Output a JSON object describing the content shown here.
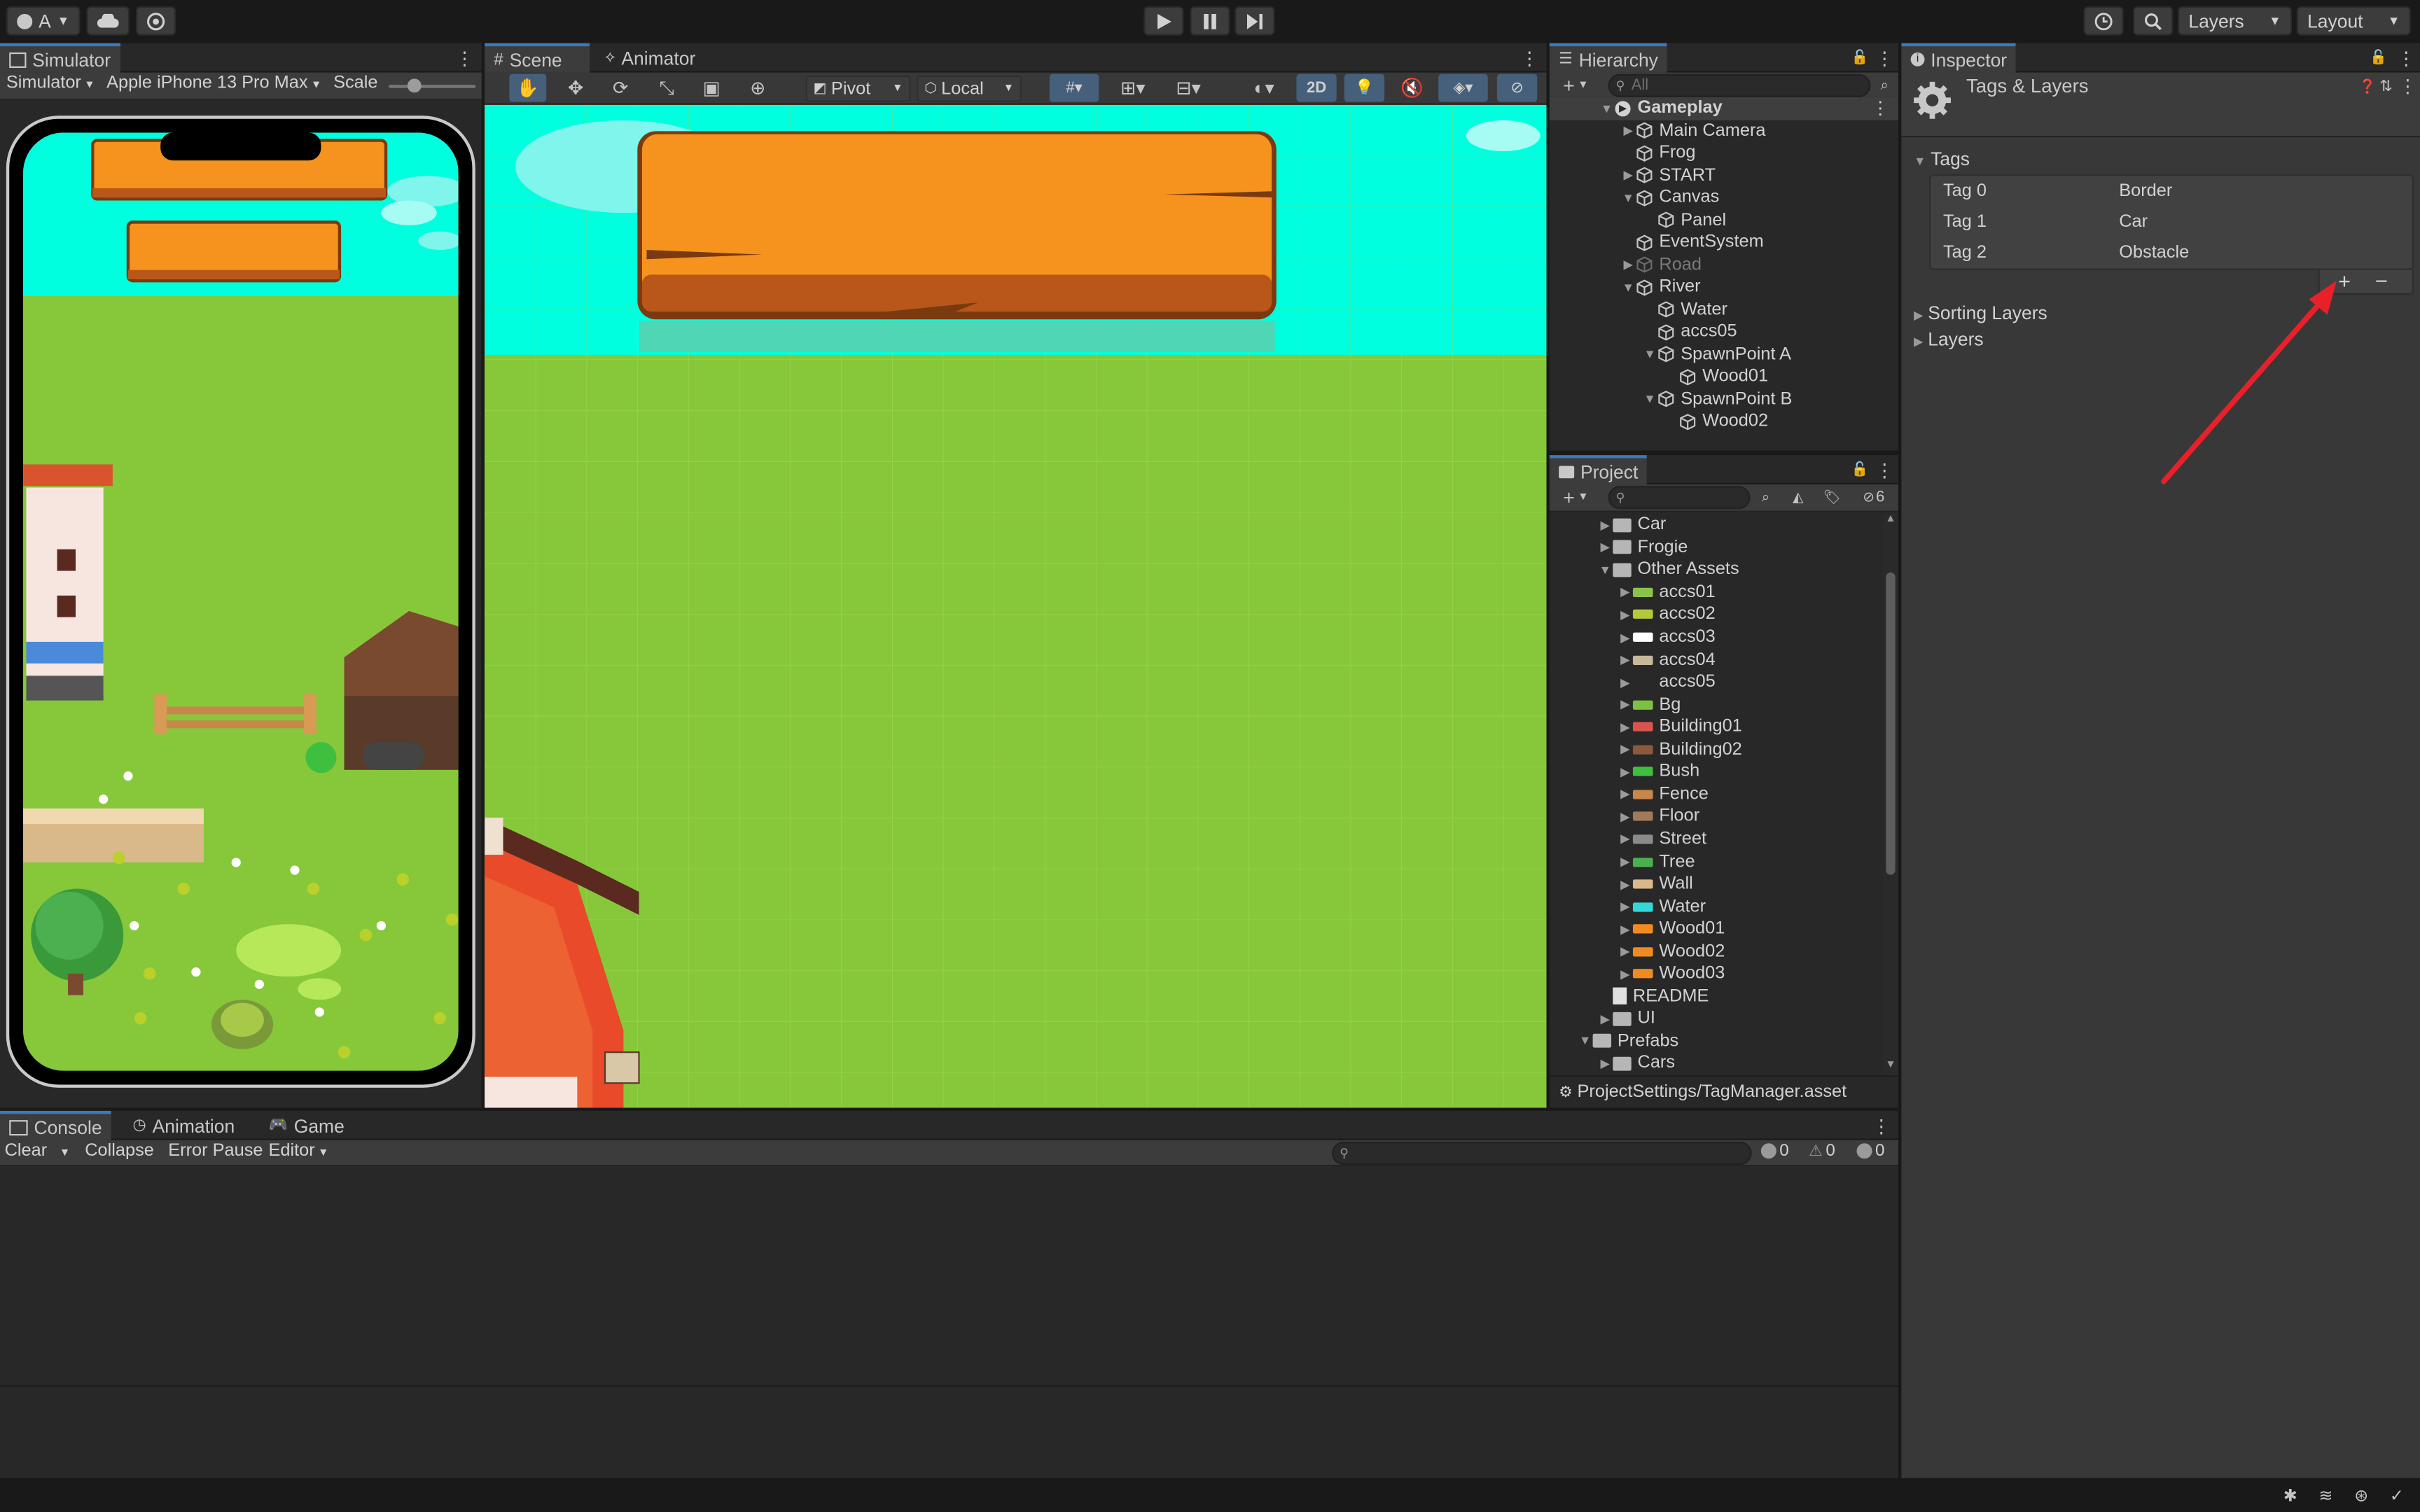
{
  "topbar": {
    "account_label": "A",
    "layers_label": "Layers",
    "layout_label": "Layout"
  },
  "simulator": {
    "tab": "Simulator",
    "mode": "Simulator",
    "device": "Apple iPhone 13 Pro Max",
    "scale_label": "Scale"
  },
  "scene": {
    "tabs": [
      "Scene",
      "Animator"
    ],
    "pivot": "Pivot",
    "local": "Local",
    "mode_2d": "2D"
  },
  "hierarchy": {
    "tab": "Hierarchy",
    "search_placeholder": "All",
    "items": [
      {
        "label": "Gameplay",
        "depth": 0,
        "arrow": "▼",
        "type": "scene",
        "bold": true
      },
      {
        "label": "Main Camera",
        "depth": 1,
        "arrow": "▶",
        "type": "object"
      },
      {
        "label": "Frog",
        "depth": 1,
        "arrow": "",
        "type": "object"
      },
      {
        "label": "START",
        "depth": 1,
        "arrow": "▶",
        "type": "object"
      },
      {
        "label": "Canvas",
        "depth": 1,
        "arrow": "▼",
        "type": "object"
      },
      {
        "label": "Panel",
        "depth": 2,
        "arrow": "",
        "type": "object"
      },
      {
        "label": "EventSystem",
        "depth": 1,
        "arrow": "",
        "type": "object"
      },
      {
        "label": "Road",
        "depth": 1,
        "arrow": "▶",
        "type": "object",
        "disabled": true
      },
      {
        "label": "River",
        "depth": 1,
        "arrow": "▼",
        "type": "object"
      },
      {
        "label": "Water",
        "depth": 2,
        "arrow": "",
        "type": "object"
      },
      {
        "label": "accs05",
        "depth": 2,
        "arrow": "",
        "type": "object"
      },
      {
        "label": "SpawnPoint A",
        "depth": 2,
        "arrow": "▼",
        "type": "object"
      },
      {
        "label": "Wood01",
        "depth": 3,
        "arrow": "",
        "type": "object"
      },
      {
        "label": "SpawnPoint B",
        "depth": 2,
        "arrow": "▼",
        "type": "object"
      },
      {
        "label": "Wood02",
        "depth": 3,
        "arrow": "",
        "type": "object"
      }
    ]
  },
  "project": {
    "tab": "Project",
    "hidden_count": "6",
    "path": "ProjectSettings/TagManager.asset",
    "items": [
      {
        "label": "Car",
        "depth": 1,
        "arrow": "▶",
        "icon": "folder"
      },
      {
        "label": "Frogie",
        "depth": 1,
        "arrow": "▶",
        "icon": "folder"
      },
      {
        "label": "Other Assets",
        "depth": 1,
        "arrow": "▼",
        "icon": "folder"
      },
      {
        "label": "accs01",
        "depth": 2,
        "arrow": "▶",
        "icon": "sprite",
        "color": "#8bc34a"
      },
      {
        "label": "accs02",
        "depth": 2,
        "arrow": "▶",
        "icon": "sprite",
        "color": "#b5c93a"
      },
      {
        "label": "accs03",
        "depth": 2,
        "arrow": "▶",
        "icon": "sprite",
        "color": "#ffffff"
      },
      {
        "label": "accs04",
        "depth": 2,
        "arrow": "▶",
        "icon": "sprite",
        "color": "#c8b89a"
      },
      {
        "label": "accs05",
        "depth": 2,
        "arrow": "▶",
        "icon": "none",
        "color": ""
      },
      {
        "label": "Bg",
        "depth": 2,
        "arrow": "▶",
        "icon": "sprite",
        "color": "#7cc242"
      },
      {
        "label": "Building01",
        "depth": 2,
        "arrow": "▶",
        "icon": "sprite",
        "color": "#d9534f"
      },
      {
        "label": "Building02",
        "depth": 2,
        "arrow": "▶",
        "icon": "sprite",
        "color": "#8b5a3c"
      },
      {
        "label": "Bush",
        "depth": 2,
        "arrow": "▶",
        "icon": "sprite",
        "color": "#3fbf3f"
      },
      {
        "label": "Fence",
        "depth": 2,
        "arrow": "▶",
        "icon": "sprite",
        "color": "#c8874a"
      },
      {
        "label": "Floor",
        "depth": 2,
        "arrow": "▶",
        "icon": "sprite",
        "color": "#a07a5a"
      },
      {
        "label": "Street",
        "depth": 2,
        "arrow": "▶",
        "icon": "sprite",
        "color": "#8a8a8a"
      },
      {
        "label": "Tree",
        "depth": 2,
        "arrow": "▶",
        "icon": "sprite",
        "color": "#4caf50"
      },
      {
        "label": "Wall",
        "depth": 2,
        "arrow": "▶",
        "icon": "sprite",
        "color": "#d9b88a"
      },
      {
        "label": "Water",
        "depth": 2,
        "arrow": "▶",
        "icon": "sprite",
        "color": "#33d7d7"
      },
      {
        "label": "Wood01",
        "depth": 2,
        "arrow": "▶",
        "icon": "sprite",
        "color": "#f28a22"
      },
      {
        "label": "Wood02",
        "depth": 2,
        "arrow": "▶",
        "icon": "sprite",
        "color": "#f28a22"
      },
      {
        "label": "Wood03",
        "depth": 2,
        "arrow": "▶",
        "icon": "sprite",
        "color": "#f28a22"
      },
      {
        "label": "README",
        "depth": 1,
        "arrow": "",
        "icon": "doc"
      },
      {
        "label": "UI",
        "depth": 1,
        "arrow": "▶",
        "icon": "folder"
      },
      {
        "label": "Prefabs",
        "depth": 0,
        "arrow": "▼",
        "icon": "folder"
      },
      {
        "label": "Cars",
        "depth": 1,
        "arrow": "▶",
        "icon": "folder"
      }
    ]
  },
  "inspector": {
    "tab": "Inspector",
    "title": "Tags & Layers",
    "tags_label": "Tags",
    "tags": [
      {
        "name": "Tag 0",
        "value": "Border"
      },
      {
        "name": "Tag 1",
        "value": "Car"
      },
      {
        "name": "Tag 2",
        "value": "Obstacle"
      }
    ],
    "add_symbol": "+",
    "remove_symbol": "−",
    "sorting_layers": "Sorting Layers",
    "layers": "Layers",
    "annotation_color": "#e8202a"
  },
  "console": {
    "tabs": [
      "Console",
      "Animation",
      "Game"
    ],
    "clear": "Clear",
    "collapse": "Collapse",
    "error_pause": "Error Pause",
    "editor": "Editor",
    "log_count": "0",
    "warn_count": "0",
    "error_count": "0"
  },
  "colors": {
    "accent": "#3a79bb",
    "sky": "#00ffdf",
    "grass": "#86c83a",
    "wood": "#f28a22"
  }
}
